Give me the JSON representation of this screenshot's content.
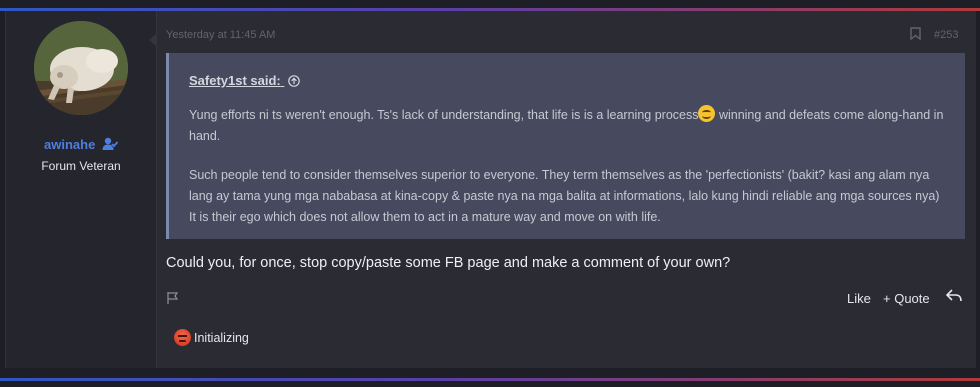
{
  "post": {
    "author": {
      "username": "awinahe",
      "title": "Forum Veteran",
      "badge_icon": "user-check-icon"
    },
    "timestamp": "Yesterday at 11:45 AM",
    "post_number": "#253",
    "quote": {
      "attribution": "Safety1st said:",
      "paragraph1_before_emoji": "Yung efforts ni ts weren't enough. Ts's lack of understanding, that life is is a learning process",
      "emoji": "smiling-face",
      "paragraph1_after_emoji": " winning and defeats come along-hand in hand.",
      "paragraph2": "Such people tend to consider themselves superior to everyone. They term themselves as the 'perfectionists' (bakit? kasi ang alam nya lang ay tama yung mga nababasa at kina-copy & paste nya na mga balita at informations, lalo kung hindi reliable ang mga sources nya) It is their ego which does not allow them to act in a mature way and move on with life."
    },
    "message": "Could you, for once, stop copy/paste some FB page and make a comment of your own?",
    "actions": {
      "like": "Like",
      "quote": "+ Quote"
    },
    "reaction": {
      "emoji": "angry-face",
      "label": "Initializing"
    }
  },
  "colors": {
    "accent_blue": "#4d7fe0",
    "quote_bg": "#474a5e",
    "post_bg": "#2a2b33"
  }
}
